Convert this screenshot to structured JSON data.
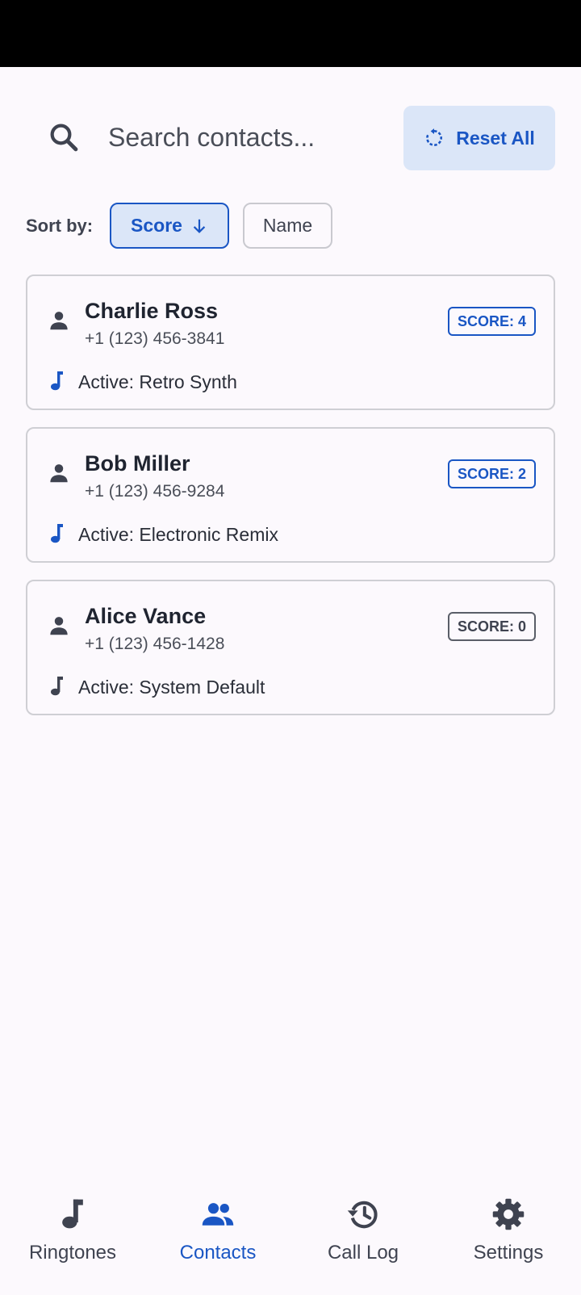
{
  "search": {
    "placeholder": "Search contacts...",
    "value": ""
  },
  "toolbar": {
    "reset_label": "Reset All"
  },
  "sort": {
    "label": "Sort by:",
    "options": [
      {
        "label": "Score",
        "selected": true,
        "direction": "descending"
      },
      {
        "label": "Name",
        "selected": false
      }
    ]
  },
  "contacts": [
    {
      "name": "Charlie Ross",
      "phone": "+1 (123) 456-3841",
      "score": "SCORE: 4",
      "ringtone": "Active: Retro Synth"
    },
    {
      "name": "Bob Miller",
      "phone": "+1 (123) 456-9284",
      "score": "SCORE: 2",
      "ringtone": "Active: Electronic Remix"
    },
    {
      "name": "Alice Vance",
      "phone": "+1 (123) 456-1428",
      "score": "SCORE: 0",
      "ringtone": "Active: System Default"
    }
  ],
  "nav": {
    "items": [
      {
        "label": "Ringtones",
        "icon": "music-note-icon"
      },
      {
        "label": "Contacts",
        "icon": "people-icon",
        "active": true
      },
      {
        "label": "Call Log",
        "icon": "history-icon"
      },
      {
        "label": "Settings",
        "icon": "gear-icon"
      }
    ]
  },
  "colors": {
    "accent": "#1a56c4",
    "accent_bg": "#dbe6f8",
    "background": "#fcf9fd"
  }
}
